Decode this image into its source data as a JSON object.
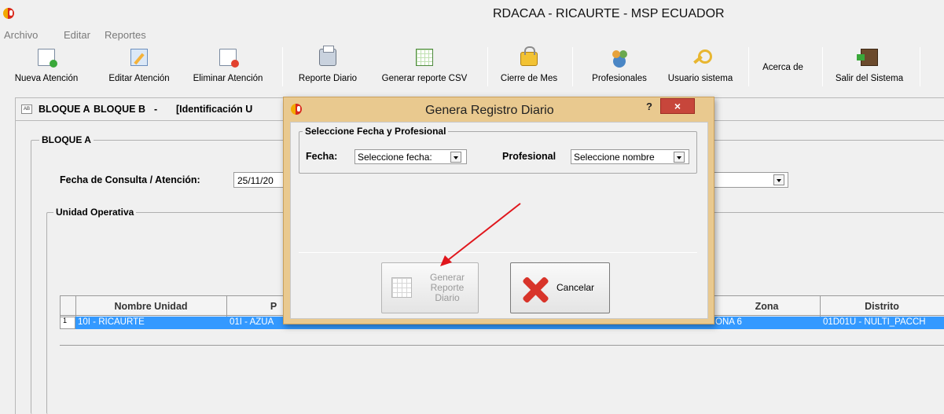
{
  "window": {
    "title": "RDACAA - RICAURTE - MSP ECUADOR"
  },
  "menu": [
    "Archivo",
    "Editar",
    "Reportes"
  ],
  "toolbar": {
    "nueva_atencion": "Nueva Atención",
    "editar_atencion": "Editar Atención",
    "eliminar_atencion": "Eliminar Atención",
    "reporte_diario": "Reporte Diario",
    "generar_csv": "Generar reporte CSV",
    "cierre_mes": "Cierre de Mes",
    "profesionales": "Profesionales",
    "usuario_sistema": "Usuario sistema",
    "acerca_de": "Acerca de",
    "salir": "Salir del Sistema"
  },
  "tabs": {
    "bloque_a": "BLOQUE A",
    "bloque_b": "BLOQUE B",
    "sep": "-",
    "identificacion": "[Identificación U"
  },
  "bloque_a": {
    "legend": "BLOQUE A",
    "fecha_label": "Fecha de Consulta / Atención:",
    "fecha_value": "25/11/20",
    "unidad_legend": "Unidad Operativa"
  },
  "grid": {
    "headers": [
      "Nombre Unidad",
      "P",
      "Zona",
      "Distrito"
    ],
    "row_number": "1",
    "row": [
      "10I - RICAURTE",
      "01I - AZUA",
      "ONA 6",
      "01D01U - NULTI_PACCH"
    ]
  },
  "dialog": {
    "title": "Genera Registro Diario",
    "help": "?",
    "close": "×",
    "group_legend": "Seleccione Fecha y Profesional",
    "fecha_label": "Fecha:",
    "fecha_value": "Seleccione fecha:",
    "profesional_label": "Profesional",
    "profesional_value": "Seleccione nombre",
    "generate_line1": "Generar",
    "generate_line2": "Reporte",
    "generate_line3": "Diario",
    "cancel": "Cancelar"
  },
  "colors": {
    "dialog_frame": "#e9c98f",
    "selection": "#3399ff",
    "close_button": "#c7463b",
    "annotation_arrow": "#e0161c"
  }
}
